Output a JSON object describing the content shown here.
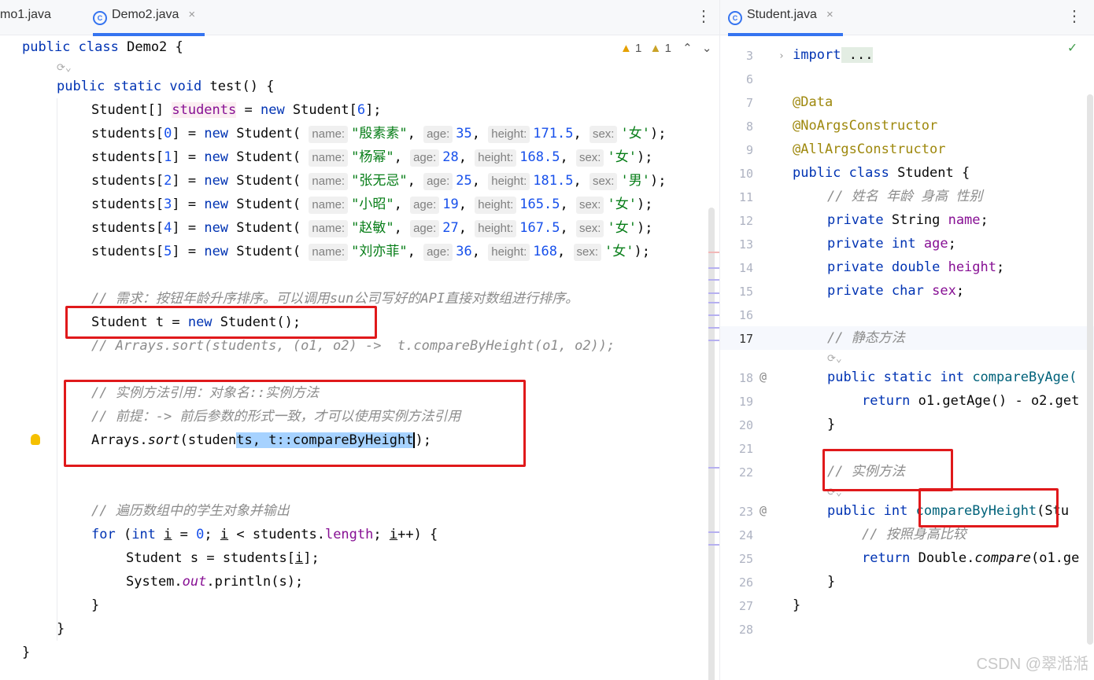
{
  "left_tabs": [
    {
      "label": "mo1.java"
    },
    {
      "label": "Demo2.java"
    }
  ],
  "right_tabs": [
    {
      "label": "Student.java"
    }
  ],
  "close_glyph": "×",
  "more_glyph": "⋮",
  "inspections": {
    "warnings": "1",
    "weak": "1",
    "up": "⌃",
    "down": "⌄"
  },
  "left_code": {
    "class_decl": [
      "public",
      "class",
      "Demo2 {"
    ],
    "method": [
      "public",
      "static",
      "void",
      "test() {"
    ],
    "arr": [
      "Student[] ",
      "students",
      " = ",
      "new",
      " Student[",
      "6",
      "];"
    ],
    "students": [
      {
        "idx": "0",
        "name": "\"殷素素\"",
        "age": "35",
        "height": "171.5",
        "sex": "'女'"
      },
      {
        "idx": "1",
        "name": "\"杨幂\"",
        "age": "28",
        "height": "168.5",
        "sex": "'女'"
      },
      {
        "idx": "2",
        "name": "\"张无忌\"",
        "age": "25",
        "height": "181.5",
        "sex": "'男'"
      },
      {
        "idx": "3",
        "name": "\"小昭\"",
        "age": "19",
        "height": "165.5",
        "sex": "'女'"
      },
      {
        "idx": "4",
        "name": "\"赵敏\"",
        "age": "27",
        "height": "167.5",
        "sex": "'女'"
      },
      {
        "idx": "5",
        "name": "\"刘亦菲\"",
        "age": "36",
        "height": "168",
        "sex": "'女'"
      }
    ],
    "hint_name": "name:",
    "hint_age": "age:",
    "hint_height": "height:",
    "hint_sex": "sex:",
    "comment_req": "// 需求：按钮年龄升序排序。可以调用sun公司写好的API直接对数组进行排序。",
    "student_t": [
      "Student t = ",
      "new",
      " Student();"
    ],
    "comment_lambda": "// Arrays.sort(students, (o1, o2) ->  t.compareByHeight(o1, o2));",
    "comment_ref1": "// 实例方法引用：对象名::实例方法",
    "comment_ref2": "// 前提：-> 前后参数的形式一致，才可以使用实例方法引用",
    "sort_call": [
      "Arrays.",
      "sort",
      "(studen",
      "ts, t::compareByHeigh",
      "t",
      ");"
    ],
    "comment_loop": "// 遍历数组中的学生对象并输出",
    "for_line": [
      "for",
      " (",
      "int",
      " ",
      "i",
      " = ",
      "0",
      "; ",
      "i",
      " < students.",
      "length",
      "; ",
      "i",
      "++) {"
    ],
    "student_s": [
      "Student s = ",
      "students",
      "[",
      "i",
      "];"
    ],
    "print": [
      "System.",
      "out",
      ".println(s);"
    ],
    "close1": "}",
    "close2": "}",
    "close3": "}"
  },
  "right_code": {
    "line_numbers": [
      "3",
      "6",
      "7",
      "8",
      "9",
      "10",
      "11",
      "12",
      "13",
      "14",
      "15",
      "16",
      "17",
      "18",
      "19",
      "20",
      "21",
      "22",
      "23",
      "24",
      "25",
      "26",
      "27",
      "28"
    ],
    "import": [
      "import",
      " ..."
    ],
    "annotations": [
      "@Data",
      "@NoArgsConstructor",
      "@AllArgsConstructor"
    ],
    "class_decl": [
      "public",
      "class",
      "Student {"
    ],
    "comment_fields": "// 姓名 年龄 身高 性别",
    "fields": [
      {
        "kw": "private",
        "type": "String",
        "name": "name"
      },
      {
        "kw": "private",
        "type": "int",
        "name": "age"
      },
      {
        "kw": "private",
        "type": "double",
        "name": "height"
      },
      {
        "kw": "private",
        "type": "char",
        "name": "sex"
      }
    ],
    "comment_static": "// 静态方法",
    "static_method": [
      "public",
      "static",
      "int",
      "compareByAge("
    ],
    "return_age": [
      "return",
      " o1.getAge() - o2.get"
    ],
    "close_a": "}",
    "comment_instance": "// 实例方法",
    "instance_method": [
      "public",
      "int",
      "compareByHeight",
      "(Stu"
    ],
    "comment_compare": "// 按照身高比较",
    "return_height": [
      "return",
      " Double.",
      "compare",
      "(o1.ge"
    ],
    "close_b": "}",
    "close_c": "}",
    "at_sign": "@",
    "check": "✓"
  },
  "watermark": "CSDN @翠湉湉"
}
